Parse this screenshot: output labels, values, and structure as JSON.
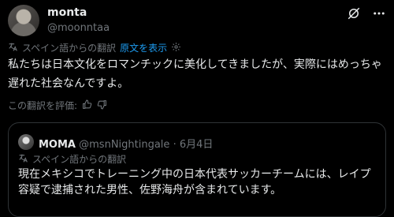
{
  "post": {
    "author_name": "monta",
    "author_handle": "@moonntaa",
    "translation_label": "スペイン語からの翻訳",
    "show_original": "原文を表示",
    "text": "私たちは日本文化をロマンチックに美化してきましたが、実際にはめっちゃ遅れた社会なんですよ。",
    "rate_label": "この翻訳を評価:"
  },
  "quote": {
    "author_name": "MOMA",
    "author_handle": "@msnNightingale",
    "separator": "·",
    "date": "6月4日",
    "translation_label": "スペイン語からの翻訳",
    "text": "現在メキシコでトレーニング中の日本代表サッカーチームには、レイプ容疑で逮捕された男性、佐野海舟が含まれています。"
  },
  "icons": {
    "top_left": "grok-icon",
    "top_right": "more-icon",
    "translate": "translate-icon",
    "settings": "gear-icon",
    "thumbs_up": "thumbs-up-icon",
    "thumbs_down": "thumbs-down-icon"
  },
  "colors": {
    "background": "#000000",
    "text": "#e7e9ea",
    "muted": "#71767b",
    "link": "#1d9bf0",
    "border": "#2f3336"
  }
}
